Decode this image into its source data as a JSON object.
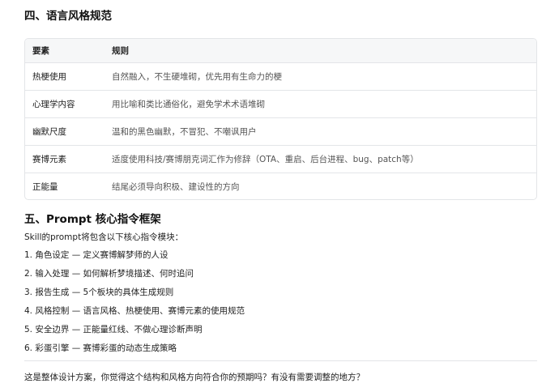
{
  "section4": {
    "title": "四、语言风格规范"
  },
  "table": {
    "headers": [
      "要素",
      "规则"
    ],
    "rows": [
      {
        "element": "热梗使用",
        "rule": "自然融入，不生硬堆砌，优先用有生命力的梗"
      },
      {
        "element": "心理学内容",
        "rule": "用比喻和类比通俗化，避免学术术语堆砌"
      },
      {
        "element": "幽默尺度",
        "rule": "温和的黑色幽默，不冒犯、不嘲讽用户"
      },
      {
        "element": "赛博元素",
        "rule": "适度使用科技/赛博朋克词汇作为修辞（OTA、重启、后台进程、bug、patch等）"
      },
      {
        "element": "正能量",
        "rule": "结尾必须导向积极、建设性的方向"
      }
    ]
  },
  "section5": {
    "title": "五、Prompt 核心指令框架",
    "intro": "Skill的prompt将包含以下核心指令模块：",
    "items": [
      "1. 角色设定 — 定义赛博解梦师的人设",
      "2. 输入处理 — 如何解析梦境描述、何时追问",
      "3. 报告生成 — 5个板块的具体生成规则",
      "4. 风格控制 — 语言风格、热梗使用、赛博元素的使用规范",
      "5. 安全边界 — 正能量红线、不做心理诊断声明",
      "6. 彩蛋引擎 — 赛博彩蛋的动态生成策略"
    ]
  },
  "closing": "这是整体设计方案，你觉得这个结构和风格方向符合你的预期吗？有没有需要调整的地方？"
}
